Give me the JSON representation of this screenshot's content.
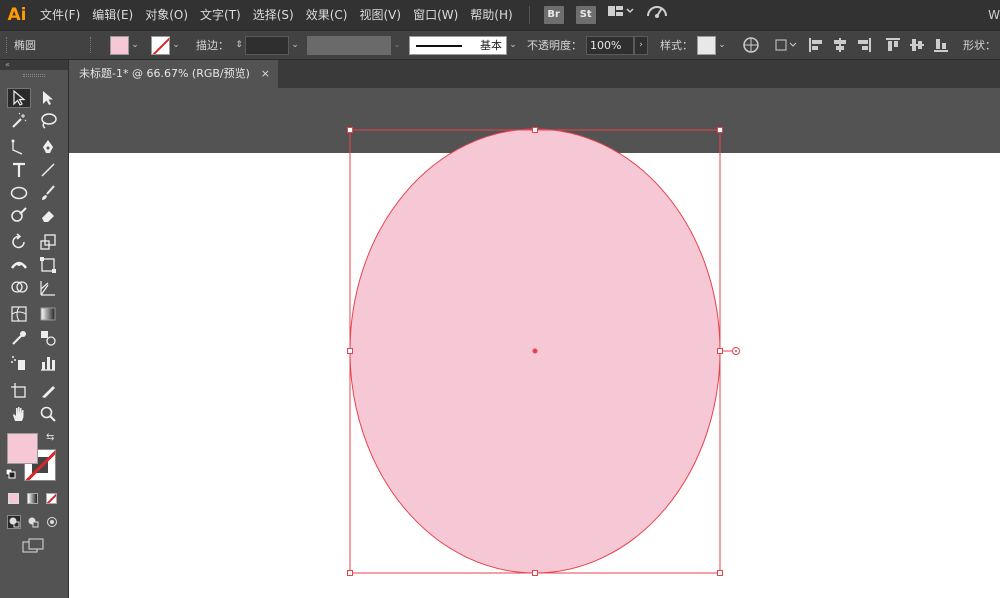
{
  "app": {
    "logo": "Ai"
  },
  "menu": {
    "items": [
      "文件(F)",
      "编辑(E)",
      "对象(O)",
      "文字(T)",
      "选择(S)",
      "效果(C)",
      "视图(V)",
      "窗口(W)",
      "帮助(H)"
    ],
    "badges": [
      "Br",
      "St"
    ],
    "right_text": "W"
  },
  "control_bar": {
    "object_type": "椭圆",
    "stroke_label": "描边：",
    "stroke_style": "基本",
    "opacity_label": "不透明度：",
    "opacity_value": "100%",
    "style_label": "样式：",
    "shape_label": "形状："
  },
  "document": {
    "tab_title": "未标题-1* @ 66.67% (RGB/预览)",
    "close_glyph": "×"
  },
  "colors": {
    "fill": "#f6c8d6",
    "stroke_none_slash": "#d8262a",
    "selection": "#e8434d",
    "menubar_bg": "#323232",
    "panel_bg": "#535353",
    "logo": "#ff9a00"
  },
  "tools": [
    "selection-tool-icon",
    "direct-selection-tool-icon",
    "magic-wand-tool-icon",
    "lasso-tool-icon",
    "pen-tool-icon",
    "curvature-tool-icon",
    "type-tool-icon",
    "line-segment-tool-icon",
    "ellipse-tool-icon",
    "paintbrush-tool-icon",
    "shaper-tool-icon",
    "eraser-tool-icon",
    "rotate-tool-icon",
    "scale-tool-icon",
    "width-tool-icon",
    "free-transform-tool-icon",
    "shape-builder-tool-icon",
    "perspective-grid-tool-icon",
    "mesh-tool-icon",
    "gradient-tool-icon",
    "eyedropper-tool-icon",
    "blend-tool-icon",
    "symbol-sprayer-tool-icon",
    "column-graph-tool-icon",
    "artboard-tool-icon",
    "slice-tool-icon",
    "hand-tool-icon",
    "zoom-tool-icon"
  ]
}
